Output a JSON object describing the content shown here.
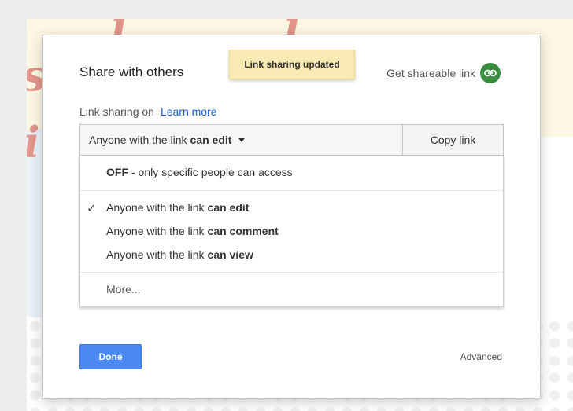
{
  "dialog": {
    "title": "Share with others",
    "toast": "Link sharing updated",
    "shareable_link_label": "Get shareable link",
    "link_status": "Link sharing on",
    "learn_more": "Learn more",
    "access": {
      "prefix": "Anyone with the link",
      "mode": "can edit"
    },
    "copy_link": "Copy link",
    "menu": {
      "off_bold": "OFF",
      "off_rest": "- only specific people can access",
      "options": [
        {
          "prefix": "Anyone with the link",
          "mode": "can edit",
          "checked": true
        },
        {
          "prefix": "Anyone with the link",
          "mode": "can comment",
          "checked": false
        },
        {
          "prefix": "Anyone with the link",
          "mode": "can view",
          "checked": false
        }
      ],
      "checkmark": "✓",
      "more": "More..."
    },
    "done": "Done",
    "advanced": "Advanced"
  },
  "background": {
    "deco_letters": [
      "s",
      "i",
      "l",
      "l"
    ]
  },
  "colors": {
    "primary_button": "#4a89f4",
    "link_blue": "#1a5fd0",
    "toast_bg": "#f9eab3",
    "link_icon_bg": "#3a8c3f"
  }
}
